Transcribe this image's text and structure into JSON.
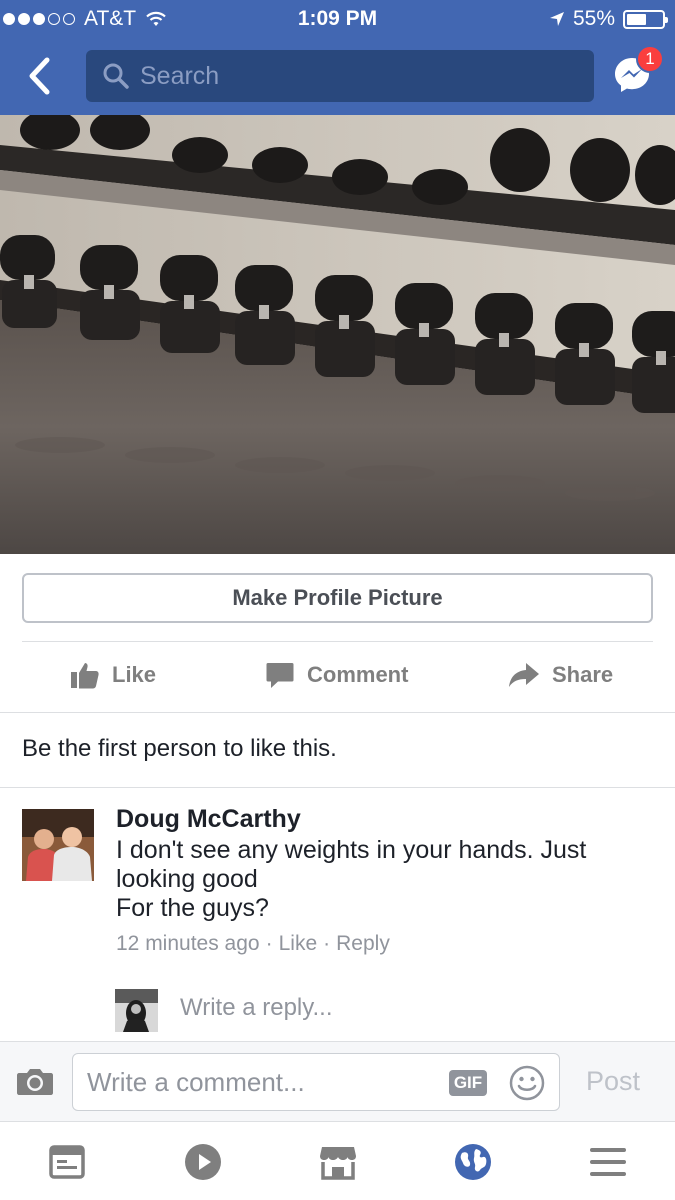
{
  "status_bar": {
    "carrier": "AT&T",
    "time": "1:09 PM",
    "battery": "55%",
    "battery_level": 0.55
  },
  "header": {
    "search_placeholder": "Search",
    "messenger_badge": "1"
  },
  "post": {
    "make_profile_picture_label": "Make Profile Picture",
    "actions": {
      "like": "Like",
      "comment": "Comment",
      "share": "Share"
    },
    "likes_summary": "Be the first person to like this."
  },
  "comment": {
    "author": "Doug McCarthy",
    "lines": [
      "I don't see any weights in your hands. Just",
      "looking good",
      "For the guys?"
    ],
    "time": "12 minutes ago",
    "like_label": "Like",
    "reply_label": "Reply",
    "separator": "·",
    "reply_placeholder": "Write a reply..."
  },
  "composer": {
    "placeholder": "Write a comment...",
    "gif_label": "GIF",
    "post_label": "Post"
  },
  "tabs": [
    "news-feed-icon",
    "video-icon",
    "marketplace-icon",
    "notifications-globe-icon",
    "menu-icon"
  ],
  "colors": {
    "brand": "#4267b2",
    "search_bg": "#29487d",
    "badge": "#fa3e3e",
    "active_tab": "#4267b2",
    "inactive_icon": "#7f7f7f"
  }
}
